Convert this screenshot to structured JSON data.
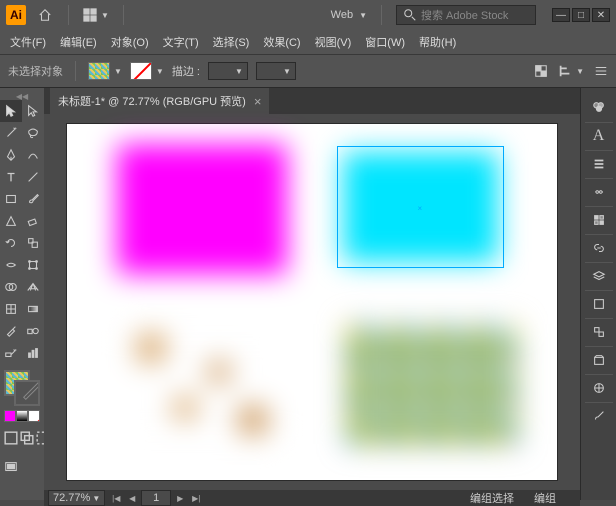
{
  "titlebar": {
    "logo": "Ai",
    "doc_preset": "Web",
    "search_placeholder": "搜索 Adobe Stock"
  },
  "menu": {
    "file": "文件(F)",
    "edit": "编辑(E)",
    "object": "对象(O)",
    "type": "文字(T)",
    "select": "选择(S)",
    "effect": "效果(C)",
    "view": "视图(V)",
    "window": "窗口(W)",
    "help": "帮助(H)"
  },
  "control": {
    "no_selection": "未选择对象",
    "stroke_label": "描边 :"
  },
  "tab": {
    "title": "未标题-1* @ 72.77% (RGB/GPU 预览)"
  },
  "status": {
    "zoom": "72.77%",
    "page": "1",
    "selection": "编组选择",
    "group": "编组"
  }
}
